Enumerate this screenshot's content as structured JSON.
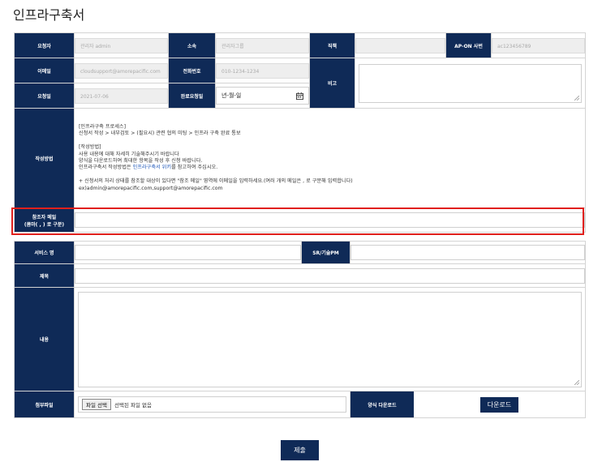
{
  "page": {
    "title": "인프라구축서"
  },
  "applicant": {
    "requester_label": "요청자",
    "requester_value": "관리자 admin",
    "dept_label": "소속",
    "dept_value": "관리자그룹",
    "position_label": "직책",
    "position_value": "",
    "apon_label": "AP-ON 사번",
    "apon_value": "ac123456789",
    "email_label": "이메일",
    "email_value": "cloudsupport@amorepacific.com",
    "phone_label": "전화번호",
    "phone_value": "010-1234-1234",
    "note_label": "비고",
    "request_date_label": "요청일",
    "request_date_value": "2021-07-06",
    "due_date_label": "완료요청일",
    "due_date_value": "년-월-일"
  },
  "guide": {
    "label": "작성방법",
    "lines": {
      "l1": "[인프라구축 프로세스]",
      "l2": "신청서 작성 > 내부검토 > (필요시) 관련 협의 미팅 > 인프라 구축 완료 통보",
      "l3": "[작성방법]",
      "l4": "사용 내용에 대해 자세히 기술해주시기 바랍니다",
      "l5": "양식을 다운로드하여 최대한 항목을 작성 후 신청 바랍니다.",
      "l6a": "인프라구축서 작성방법은 ",
      "l6link": "인프라구축서 위키",
      "l6b": "를 참고하여 주십시오.",
      "l7": "+ 신청서의 처리 상태를 참조할 대상이 있다면 \"참조 메일\" 영역에 이메일을 입력하세요.(여러 개의 메일은 , 로 구분해 입력합니다)",
      "l8": "ex)admin@amorepacific.com,support@amorepacific.com"
    }
  },
  "cc": {
    "label_line1": "참조자 메일",
    "label_line2": "(콤마( , ) 로 구분)",
    "value": ""
  },
  "service": {
    "service_name_label": "서비스 명",
    "service_name_value": "",
    "sr_label": "SR/기술PM",
    "sr_value": "",
    "subject_label": "제목",
    "subject_value": "",
    "content_label": "내용",
    "content_value": "",
    "attach_label": "첨부파일",
    "file_button": "파일 선택",
    "file_status": "선택된 파일 없음",
    "template_label": "양식 다운로드",
    "download_button": "다운로드"
  },
  "actions": {
    "submit_label": "제출"
  },
  "colors": {
    "header_navy": "#0f2a57",
    "highlight_red": "#e0201c"
  }
}
